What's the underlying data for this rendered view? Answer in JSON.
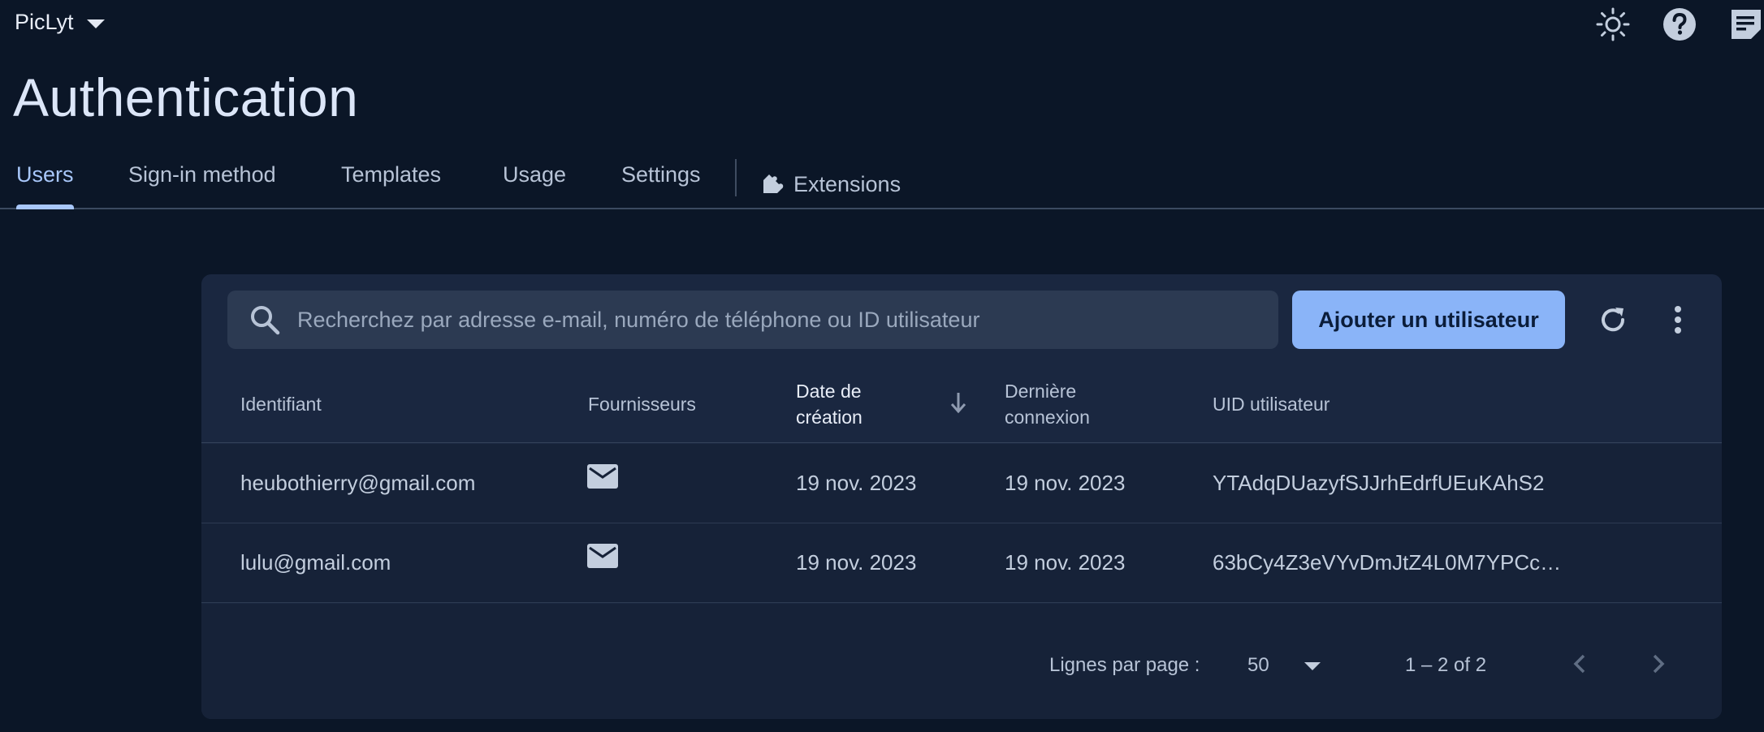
{
  "app": {
    "project_name": "PicLyt"
  },
  "header_icons": [
    "sun-icon",
    "help-icon",
    "feedback-icon"
  ],
  "page": {
    "title": "Authentication"
  },
  "tabs": [
    {
      "label": "Users",
      "active": true
    },
    {
      "label": "Sign-in method"
    },
    {
      "label": "Templates"
    },
    {
      "label": "Usage"
    },
    {
      "label": "Settings"
    },
    {
      "label": "Extensions",
      "icon": "extension-icon"
    }
  ],
  "toolbar": {
    "search_placeholder": "Recherchez par adresse e-mail, numéro de téléphone ou ID utilisateur",
    "add_user_label": "Ajouter un utilisateur"
  },
  "table": {
    "columns": {
      "identifier": "Identifiant",
      "providers": "Fournisseurs",
      "created_line1": "Date de",
      "created_line2": "création",
      "last_login_line1": "Dernière",
      "last_login_line2": "connexion",
      "uid": "UID utilisateur"
    },
    "rows": [
      {
        "identifier": "heubothierry@gmail.com",
        "provider": "email-icon",
        "created": "19 nov. 2023",
        "last_login": "19 nov. 2023",
        "uid": "YTAdqDUazyfSJJrhEdrfUEuKAhS2"
      },
      {
        "identifier": "lulu@gmail.com",
        "provider": "email-icon",
        "created": "19 nov. 2023",
        "last_login": "19 nov. 2023",
        "uid": "63bCy4Z3eVYvDmJtZ4L0M7YPCc…"
      }
    ]
  },
  "pagination": {
    "rows_per_page_label": "Lignes par page :",
    "rows_per_page_value": "50",
    "range": "1 – 2 of 2"
  },
  "colors": {
    "background": "#0b1627",
    "card": "#1a2740",
    "accent": "#8ab4f8",
    "active_tab": "#a8c7fa"
  }
}
